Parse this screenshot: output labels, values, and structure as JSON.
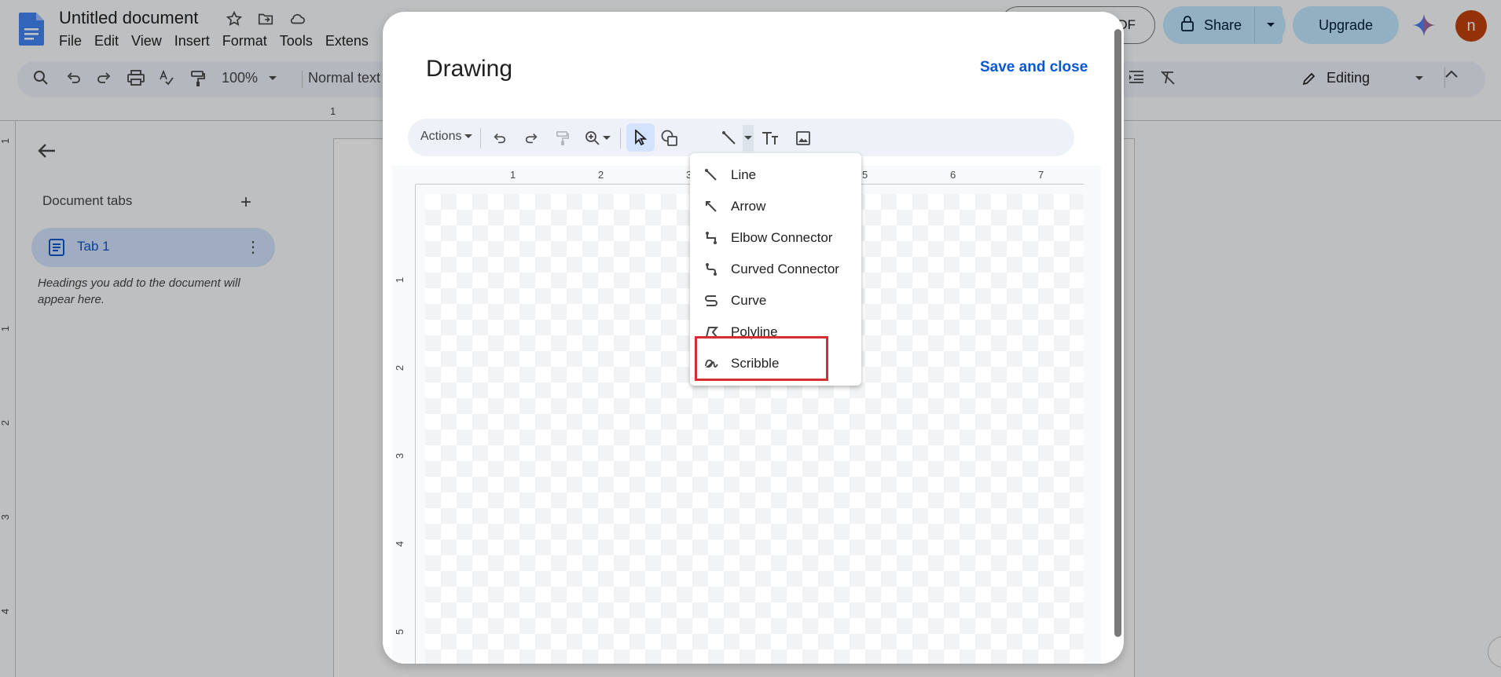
{
  "document": {
    "title": "Untitled document",
    "menu": [
      "File",
      "Edit",
      "View",
      "Insert",
      "Format",
      "Tools",
      "Extens"
    ]
  },
  "header": {
    "pdf_label": "DF",
    "share_label": "Share",
    "upgrade_label": "Upgrade",
    "avatar_letter": "n"
  },
  "toolbar": {
    "zoom": "100%",
    "style": "Normal text",
    "mode": "Editing"
  },
  "sidebar": {
    "section_title": "Document tabs",
    "add_symbol": "+",
    "tab_label": "Tab 1",
    "more_symbol": "⋮",
    "hint": "Headings you add to the document will appear here."
  },
  "ruler": {
    "page_h_marker": "1",
    "page_v_labels": [
      "1",
      "1",
      "2",
      "3",
      "4"
    ]
  },
  "drawing_dialog": {
    "title": "Drawing",
    "save_close": "Save and close",
    "actions_label": "Actions",
    "ruler_h": [
      "1",
      "2",
      "3",
      "5",
      "6",
      "7"
    ],
    "ruler_v": [
      "1",
      "2",
      "3",
      "4",
      "5"
    ]
  },
  "line_menu": {
    "items": [
      "Line",
      "Arrow",
      "Elbow Connector",
      "Curved Connector",
      "Curve",
      "Polyline",
      "Scribble"
    ],
    "icons": [
      "line-icon",
      "arrow-icon",
      "elbow-connector-icon",
      "curved-connector-icon",
      "curve-icon",
      "polyline-icon",
      "scribble-icon"
    ],
    "highlighted": "Scribble"
  },
  "colors": {
    "accent": "#0b57d0",
    "share_bg": "#c2e7ff",
    "highlight": "#d32f2f",
    "avatar": "#c2410c"
  }
}
